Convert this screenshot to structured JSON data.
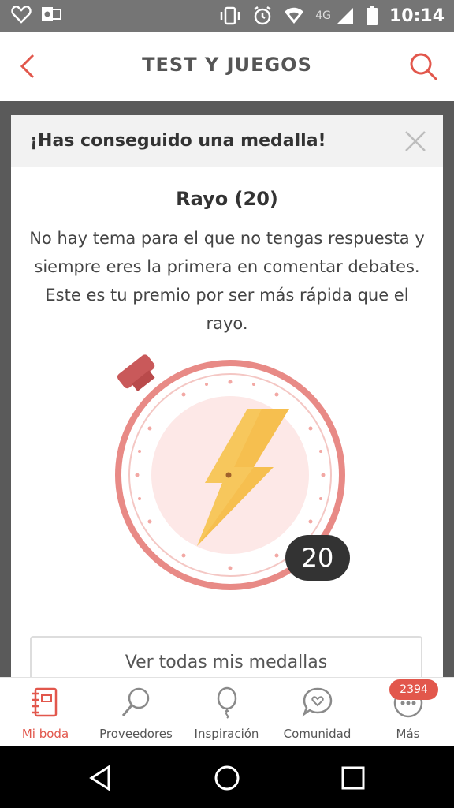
{
  "status_bar": {
    "network": "4G",
    "time": "10:14"
  },
  "header": {
    "title": "TEST Y JUEGOS"
  },
  "modal": {
    "title": "¡Has conseguido una medalla!",
    "medal_name": "Rayo (20)",
    "description": "No hay tema para el que no tengas respuesta y siempre eres la primera en comentar debates. Este es tu premio por ser más rápida que el rayo.",
    "medal_count": "20",
    "button_label": "Ver todas mis medallas"
  },
  "bottom_nav": {
    "items": [
      {
        "label": "Mi boda",
        "icon": "notebook-icon",
        "active": true
      },
      {
        "label": "Proveedores",
        "icon": "magnifier-icon",
        "active": false
      },
      {
        "label": "Inspiración",
        "icon": "balloon-icon",
        "active": false
      },
      {
        "label": "Comunidad",
        "icon": "chat-heart-icon",
        "active": false
      },
      {
        "label": "Más",
        "icon": "more-icon",
        "active": false
      }
    ],
    "badge": "2394"
  },
  "colors": {
    "accent": "#e2574c",
    "medal_ring": "#e88a86",
    "bolt": "#f6bf4f"
  }
}
